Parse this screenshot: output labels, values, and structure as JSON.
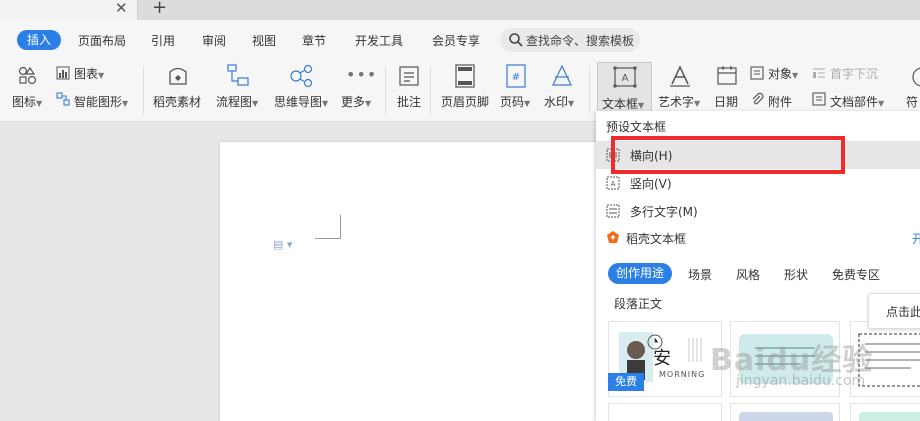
{
  "titlebar": {
    "close_glyph": "✕",
    "new_tab_glyph": "+"
  },
  "menu": {
    "insert": "插入",
    "items": [
      "页面布局",
      "引用",
      "审阅",
      "视图",
      "章节",
      "开发工具",
      "会员专享"
    ],
    "search_placeholder": "查找命令、搜索模板"
  },
  "ribbon": {
    "chart": "图表",
    "icons": "图标",
    "smart_graphic": "智能图形",
    "daoke_material": "稻壳素材",
    "flowchart": "流程图",
    "mindmap": "思维导图",
    "more": "更多",
    "comment": "批注",
    "header_footer": "页眉页脚",
    "page_number": "页码",
    "watermark": "水印",
    "textbox": "文本框",
    "wordart": "艺术字",
    "date": "日期",
    "object": "对象",
    "attachment": "附件",
    "drop_cap": "首字下沉",
    "doc_parts": "文档部件",
    "symbol_partial": "符"
  },
  "dropdown": {
    "preset_header": "预设文本框",
    "options": [
      {
        "label": "横向(H)",
        "icon": "horizontal-textbox-icon"
      },
      {
        "label": "竖向(V)",
        "icon": "vertical-textbox-icon"
      },
      {
        "label": "多行文字(M)",
        "icon": "multiline-textbox-icon"
      }
    ],
    "daoke_textbox": "稻壳文本框",
    "open_link": "开",
    "pills": [
      "创作用途",
      "场景",
      "风格",
      "形状",
      "免费专区"
    ],
    "section_title": "段落正文",
    "free_badge": "免费",
    "thumb_text_big": "安",
    "thumb_text_small": "MORNING",
    "tooltip": "点击此"
  },
  "watermark": {
    "brand": "Baidu经验",
    "url": "jingyan.baidu.com"
  },
  "colors": {
    "accent": "#2b7fe6",
    "highlight": "#ee2a2a",
    "daoke_orange": "#f26b1d"
  }
}
